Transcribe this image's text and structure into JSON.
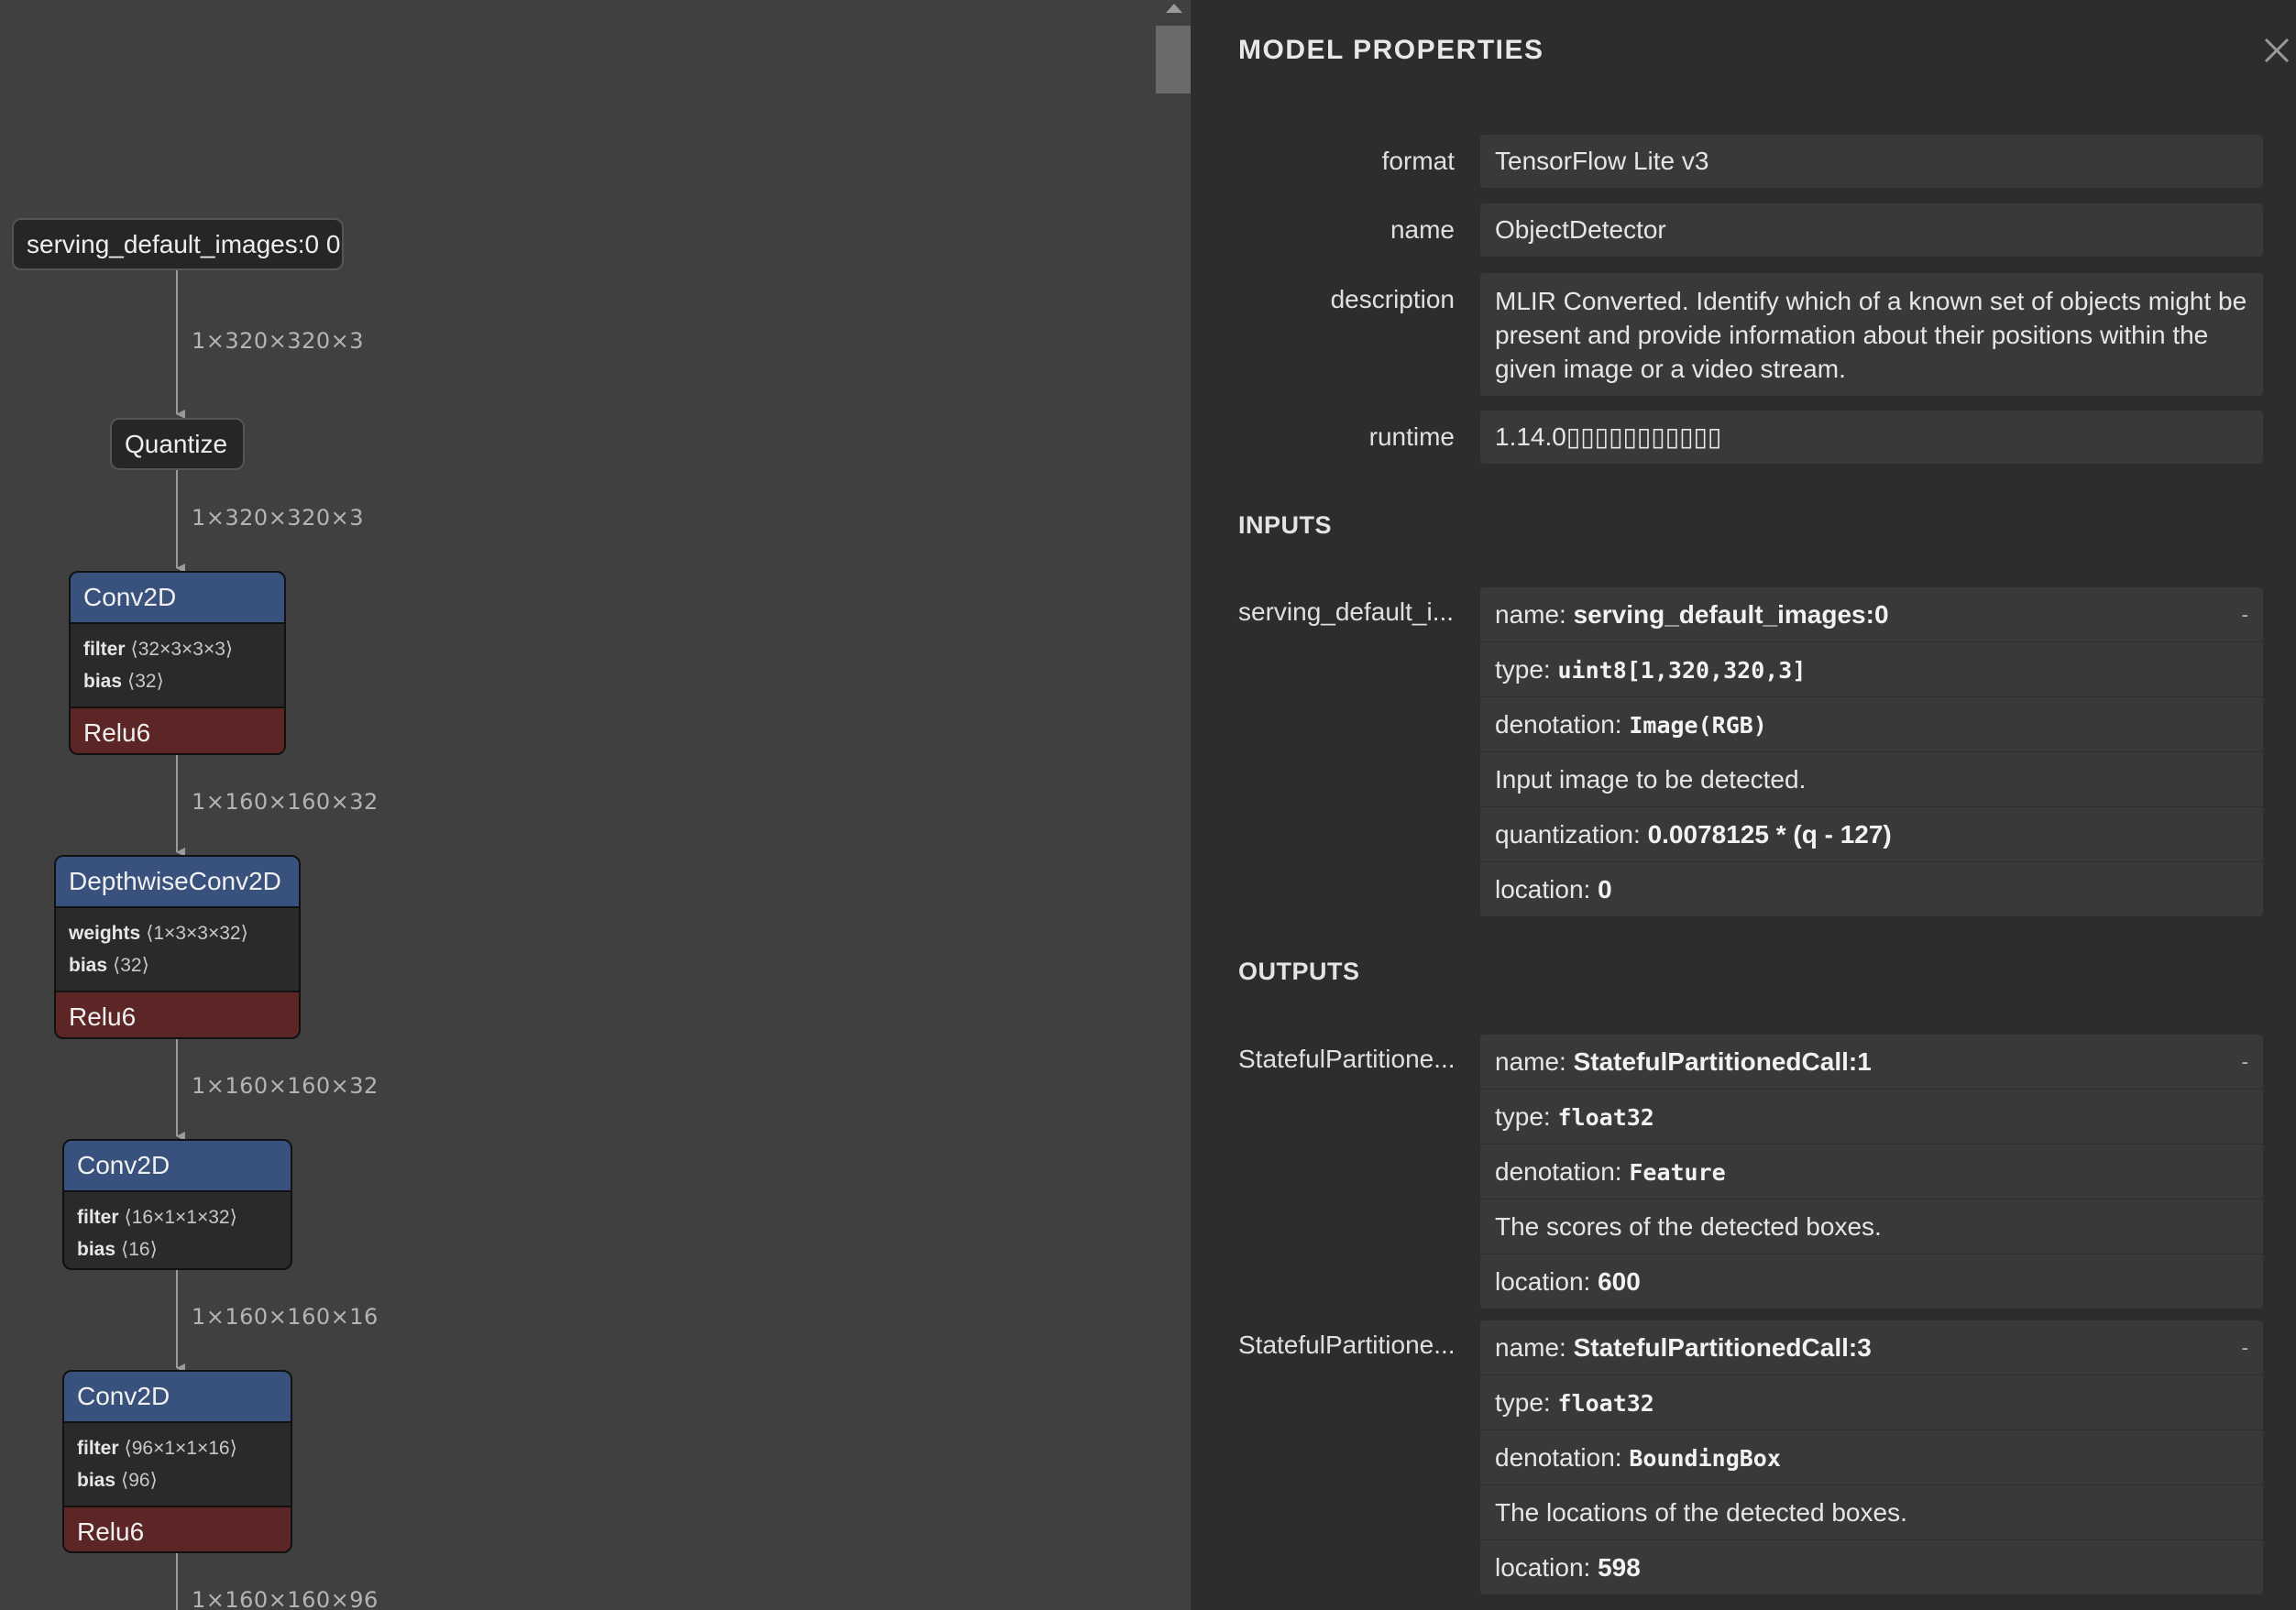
{
  "graph": {
    "input_node": {
      "label": "serving_default_images:0 0"
    },
    "quantize_node": {
      "label": "Quantize"
    },
    "edges": [
      "1×320×320×3",
      "1×320×320×3",
      "1×160×160×32",
      "1×160×160×32",
      "1×160×160×16",
      "1×160×160×96"
    ],
    "nodes": [
      {
        "op": "Conv2D",
        "attrs": [
          {
            "name": "filter",
            "shape": "⟨32×3×3×3⟩"
          },
          {
            "name": "bias",
            "shape": "⟨32⟩"
          }
        ],
        "activation": "Relu6"
      },
      {
        "op": "DepthwiseConv2D",
        "attrs": [
          {
            "name": "weights",
            "shape": "⟨1×3×3×32⟩"
          },
          {
            "name": "bias",
            "shape": "⟨32⟩"
          }
        ],
        "activation": "Relu6"
      },
      {
        "op": "Conv2D",
        "attrs": [
          {
            "name": "filter",
            "shape": "⟨16×1×1×32⟩"
          },
          {
            "name": "bias",
            "shape": "⟨16⟩"
          }
        ],
        "activation": ""
      },
      {
        "op": "Conv2D",
        "attrs": [
          {
            "name": "filter",
            "shape": "⟨96×1×1×16⟩"
          },
          {
            "name": "bias",
            "shape": "⟨96⟩"
          }
        ],
        "activation": "Relu6"
      }
    ]
  },
  "panel": {
    "title": "MODEL PROPERTIES",
    "properties": [
      {
        "label": "format",
        "value": "TensorFlow Lite v3"
      },
      {
        "label": "name",
        "value": "ObjectDetector"
      },
      {
        "label": "description",
        "value": "MLIR Converted. Identify which of a known set of objects might be present and provide information about their positions within the given image or a video stream."
      },
      {
        "label": "runtime",
        "value": "1.14.0▯▯▯▯▯▯▯▯▯▯▯"
      }
    ],
    "inputs_title": "INPUTS",
    "inputs": [
      {
        "label": "serving_default_i...",
        "toggle": "-",
        "name_key": "name: ",
        "name": "serving_default_images:0",
        "type_key": "type: ",
        "type": "uint8[1,320,320,3]",
        "denotation_key": "denotation: ",
        "denotation": "Image(RGB)",
        "description": "Input image to be detected.",
        "quantization_key": "quantization: ",
        "quantization": "0.0078125 * (q - 127)",
        "location_key": "location: ",
        "location": "0"
      }
    ],
    "outputs_title": "OUTPUTS",
    "outputs": [
      {
        "label": "StatefulPartitione...",
        "toggle": "-",
        "name_key": "name: ",
        "name": "StatefulPartitionedCall:1",
        "type_key": "type: ",
        "type": "float32",
        "denotation_key": "denotation: ",
        "denotation": "Feature",
        "description": "The scores of the detected boxes.",
        "location_key": "location: ",
        "location": "600"
      },
      {
        "label": "StatefulPartitione...",
        "toggle": "-",
        "name_key": "name: ",
        "name": "StatefulPartitionedCall:3",
        "type_key": "type: ",
        "type": "float32",
        "denotation_key": "denotation: ",
        "denotation": "BoundingBox",
        "description": "The locations of the detected boxes.",
        "location_key": "location: ",
        "location": "598"
      }
    ]
  }
}
